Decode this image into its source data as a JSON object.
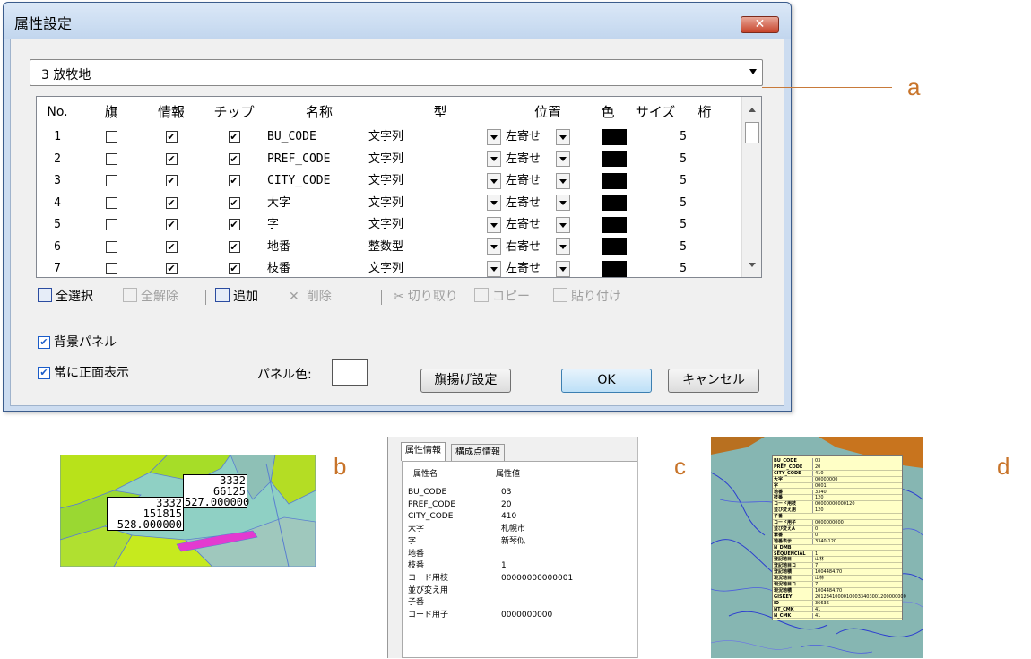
{
  "dialog": {
    "title": "属性設定",
    "close_label": "✕",
    "layer_select": "3 放牧地",
    "columns": [
      "No.",
      "旗",
      "情報",
      "チップ",
      "名称",
      "型",
      "位置",
      "色",
      "サイズ",
      "桁"
    ],
    "rows": [
      {
        "no": "1",
        "flag": false,
        "info": true,
        "chip": true,
        "name": "BU_CODE",
        "type": "文字列",
        "position": "左寄せ",
        "color": "#000000",
        "size": "5"
      },
      {
        "no": "2",
        "flag": false,
        "info": true,
        "chip": true,
        "name": "PREF_CODE",
        "type": "文字列",
        "position": "左寄せ",
        "color": "#000000",
        "size": "5"
      },
      {
        "no": "3",
        "flag": false,
        "info": true,
        "chip": true,
        "name": "CITY_CODE",
        "type": "文字列",
        "position": "左寄せ",
        "color": "#000000",
        "size": "5"
      },
      {
        "no": "4",
        "flag": false,
        "info": true,
        "chip": true,
        "name": "大字",
        "type": "文字列",
        "position": "左寄せ",
        "color": "#000000",
        "size": "5"
      },
      {
        "no": "5",
        "flag": false,
        "info": true,
        "chip": true,
        "name": "字",
        "type": "文字列",
        "position": "左寄せ",
        "color": "#000000",
        "size": "5"
      },
      {
        "no": "6",
        "flag": false,
        "info": true,
        "chip": true,
        "name": "地番",
        "type": "整数型",
        "position": "右寄せ",
        "color": "#000000",
        "size": "5"
      },
      {
        "no": "7",
        "flag": false,
        "info": true,
        "chip": true,
        "name": "枝番",
        "type": "文字列",
        "position": "左寄せ",
        "color": "#000000",
        "size": "5"
      }
    ],
    "toolbar": {
      "select_all": "全選択",
      "deselect_all": "全解除",
      "add": "追加",
      "delete": "削除",
      "cut": "切り取り",
      "copy": "コピー",
      "paste": "貼り付け"
    },
    "bg_panel_label": "背景パネル",
    "always_front_label": "常に正面表示",
    "panel_color_label": "パネル色:",
    "flag_settings_label": "旗揚げ設定",
    "ok_label": "OK",
    "cancel_label": "キャンセル"
  },
  "callouts": {
    "a": "a",
    "b": "b",
    "c": "c",
    "d": "d"
  },
  "map_b": {
    "label1": [
      "3332",
      "66125",
      "527.000000"
    ],
    "label2": [
      "3332",
      "151815",
      "528.000000"
    ]
  },
  "panel_c": {
    "tab1": "属性情報",
    "tab2": "構成点情報",
    "header_key": "属性名",
    "header_val": "属性値",
    "rows": [
      {
        "k": "BU_CODE",
        "v": "03"
      },
      {
        "k": "PREF_CODE",
        "v": "20"
      },
      {
        "k": "CITY_CODE",
        "v": "410"
      },
      {
        "k": "大字",
        "v": "札幌市"
      },
      {
        "k": "字",
        "v": "新琴似"
      },
      {
        "k": "地番",
        "v": ""
      },
      {
        "k": "枝番",
        "v": "1"
      },
      {
        "k": "コード用枝",
        "v": "00000000000001"
      },
      {
        "k": "並び変え用",
        "v": ""
      },
      {
        "k": "子番",
        "v": ""
      },
      {
        "k": "コード用子",
        "v": "0000000000"
      }
    ]
  },
  "panel_d": {
    "rows": [
      {
        "k": "BU_CODE",
        "v": "03"
      },
      {
        "k": "PREF_CODE",
        "v": "20"
      },
      {
        "k": "CITY_CODE",
        "v": "410"
      },
      {
        "k": "大字",
        "v": "00000000"
      },
      {
        "k": "字",
        "v": "0001"
      },
      {
        "k": "地番",
        "v": "3340"
      },
      {
        "k": "枝番",
        "v": "120"
      },
      {
        "k": "コード用枝",
        "v": "00000000000120"
      },
      {
        "k": "並び変え用",
        "v": "120"
      },
      {
        "k": "子番",
        "v": ""
      },
      {
        "k": "コード用子",
        "v": "0000000000"
      },
      {
        "k": "並び変えA",
        "v": "0"
      },
      {
        "k": "筆番",
        "v": "0"
      },
      {
        "k": "地番表示",
        "v": "3340-120"
      },
      {
        "k": "N_DMB",
        "v": ""
      },
      {
        "k": "SEQUENCIAL",
        "v": "1"
      },
      {
        "k": "登記地目",
        "v": "山林"
      },
      {
        "k": "登記地目コ",
        "v": "7"
      },
      {
        "k": "登記地積",
        "v": "1004484.70"
      },
      {
        "k": "現況地目",
        "v": "山林"
      },
      {
        "k": "現況地目コ",
        "v": "7"
      },
      {
        "k": "現況地積",
        "v": "1004484.70"
      },
      {
        "k": "GISKEY",
        "v": "20123410000100033403001200000000"
      },
      {
        "k": "ID",
        "v": "36636"
      },
      {
        "k": "NT_CMK",
        "v": "41"
      },
      {
        "k": "N_CMK",
        "v": "41"
      }
    ]
  },
  "colors": {
    "callout": "#c8742a",
    "check": "#1a5cc9"
  }
}
